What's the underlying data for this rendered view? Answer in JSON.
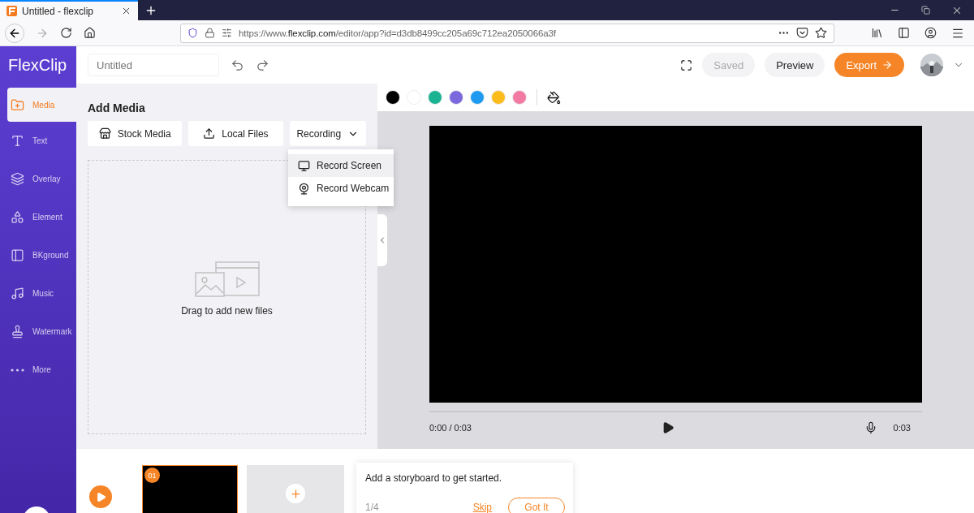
{
  "browser": {
    "tab_title": "Untitled - flexclip",
    "url_prefix": "https://www.",
    "url_domain": "flexclip.com",
    "url_rest": "/editor/app?id=d3db8499cc205a69c712ea2050066a3f"
  },
  "sidebar": {
    "logo": "FlexClip",
    "items": [
      {
        "label": "Media",
        "selected": true
      },
      {
        "label": "Text",
        "selected": false
      },
      {
        "label": "Overlay",
        "selected": false
      },
      {
        "label": "Element",
        "selected": false
      },
      {
        "label": "BKground",
        "selected": false
      },
      {
        "label": "Music",
        "selected": false
      },
      {
        "label": "Watermark",
        "selected": false
      },
      {
        "label": "More",
        "selected": false
      }
    ]
  },
  "header": {
    "title_placeholder": "Untitled",
    "saved": "Saved",
    "preview": "Preview",
    "export": "Export"
  },
  "panel": {
    "title": "Add Media",
    "buttons": [
      {
        "label": "Stock Media",
        "kind": "leading"
      },
      {
        "label": "Local Files",
        "kind": "leading"
      },
      {
        "label": "Recording",
        "kind": "dropdown"
      }
    ],
    "menu": [
      {
        "label": "Record Screen",
        "selected": true
      },
      {
        "label": "Record Webcam",
        "selected": false
      }
    ],
    "drop_hint": "Drag to add new files"
  },
  "swatches": [
    {
      "color": "#000000"
    },
    {
      "color": "#ffffff"
    },
    {
      "color": "#1bb394"
    },
    {
      "color": "#7b68dd"
    },
    {
      "color": "#1e9bf0"
    },
    {
      "color": "#fbbc1b"
    },
    {
      "color": "#f27aa3"
    }
  ],
  "player": {
    "time": "0:00 / 0:03",
    "duration": "0:03"
  },
  "timeline": {
    "clips": [
      {
        "number": "01",
        "selected": true
      }
    ],
    "tip": {
      "text": "Add a storyboard to get started.",
      "step": "1/4",
      "skip": "Skip",
      "ok": "Got It"
    }
  }
}
